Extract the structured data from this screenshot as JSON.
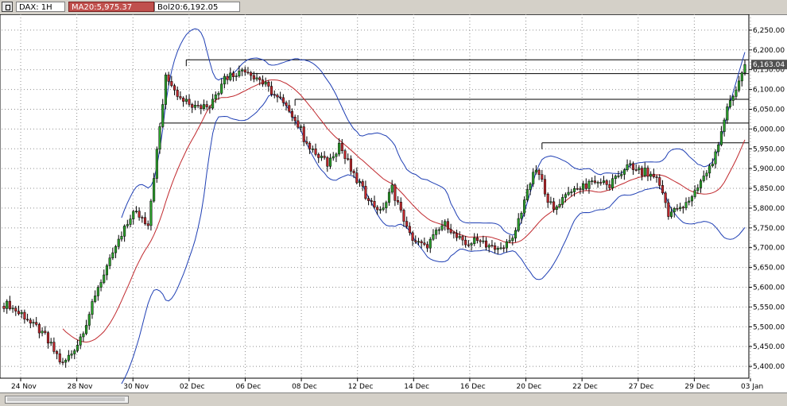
{
  "header": {
    "symbol_label": "DAX: 1H",
    "ma_label": "MA20:5,975.37",
    "bol_label": "Bol20:6,192.05"
  },
  "colors": {
    "bull": "#2ca02c",
    "bear": "#c0282d",
    "ma": "#c0282d",
    "bollinger": "#1f3fb4",
    "grid": "#909090",
    "price_tag_bg": "#505050"
  },
  "chart_data": {
    "type": "candlestick",
    "ylim": [
      5370,
      6290
    ],
    "y_ticks": [
      5400,
      5450,
      5500,
      5550,
      5600,
      5650,
      5700,
      5750,
      5800,
      5850,
      5900,
      5950,
      6000,
      6050,
      6100,
      6150,
      6200,
      6250
    ],
    "y_tick_labels": [
      "5,400.00",
      "5,450.00",
      "5,500.00",
      "5,550.00",
      "5,600.00",
      "5,650.00",
      "5,700.00",
      "5,750.00",
      "5,800.00",
      "5,850.00",
      "5,900.00",
      "5,950.00",
      "6,000.00",
      "6,050.00",
      "6,100.00",
      "6,150.00",
      "6,200.00",
      "6,250.00"
    ],
    "x_labels": [
      "24 Nov",
      "28 Nov",
      "30 Nov",
      "02 Dec",
      "06 Dec",
      "08 Dec",
      "12 Dec",
      "14 Dec",
      "16 Dec",
      "20 Dec",
      "22 Dec",
      "27 Dec",
      "29 Dec",
      "03 Jan"
    ],
    "last_price": 6163.04,
    "last_price_label": "6,163.04",
    "candle_count": 253,
    "close_path": [
      {
        "i": 0,
        "c": 5560
      },
      {
        "i": 8,
        "c": 5520
      },
      {
        "i": 14,
        "c": 5475
      },
      {
        "i": 20,
        "c": 5405
      },
      {
        "i": 26,
        "c": 5470
      },
      {
        "i": 32,
        "c": 5600
      },
      {
        "i": 38,
        "c": 5700
      },
      {
        "i": 44,
        "c": 5790
      },
      {
        "i": 49,
        "c": 5760
      },
      {
        "i": 55,
        "c": 6130
      },
      {
        "i": 60,
        "c": 6080
      },
      {
        "i": 66,
        "c": 6060
      },
      {
        "i": 70,
        "c": 6060
      },
      {
        "i": 75,
        "c": 6130
      },
      {
        "i": 82,
        "c": 6150
      },
      {
        "i": 90,
        "c": 6105
      },
      {
        "i": 98,
        "c": 6040
      },
      {
        "i": 104,
        "c": 5950
      },
      {
        "i": 110,
        "c": 5910
      },
      {
        "i": 114,
        "c": 5960
      },
      {
        "i": 120,
        "c": 5870
      },
      {
        "i": 124,
        "c": 5825
      },
      {
        "i": 128,
        "c": 5790
      },
      {
        "i": 132,
        "c": 5850
      },
      {
        "i": 138,
        "c": 5730
      },
      {
        "i": 143,
        "c": 5700
      },
      {
        "i": 150,
        "c": 5760
      },
      {
        "i": 156,
        "c": 5710
      },
      {
        "i": 162,
        "c": 5720
      },
      {
        "i": 167,
        "c": 5690
      },
      {
        "i": 173,
        "c": 5720
      },
      {
        "i": 177,
        "c": 5820
      },
      {
        "i": 181,
        "c": 5900
      },
      {
        "i": 187,
        "c": 5790
      },
      {
        "i": 191,
        "c": 5840
      },
      {
        "i": 196,
        "c": 5850
      },
      {
        "i": 200,
        "c": 5870
      },
      {
        "i": 206,
        "c": 5860
      },
      {
        "i": 212,
        "c": 5905
      },
      {
        "i": 218,
        "c": 5890
      },
      {
        "i": 222,
        "c": 5880
      },
      {
        "i": 226,
        "c": 5790
      },
      {
        "i": 231,
        "c": 5800
      },
      {
        "i": 236,
        "c": 5855
      },
      {
        "i": 241,
        "c": 5910
      },
      {
        "i": 246,
        "c": 6050
      },
      {
        "i": 249,
        "c": 6100
      },
      {
        "i": 252,
        "c": 6163
      }
    ],
    "horizontal_lines": [
      {
        "start_i": 62,
        "end_i": 253,
        "price": 6175
      },
      {
        "start_i": 84,
        "end_i": 253,
        "price": 6140
      },
      {
        "start_i": 99,
        "end_i": 253,
        "price": 6075
      },
      {
        "start_i": 53,
        "end_i": 253,
        "price": 6015
      },
      {
        "start_i": 183,
        "end_i": 253,
        "price": 5965
      }
    ],
    "grid": true
  }
}
